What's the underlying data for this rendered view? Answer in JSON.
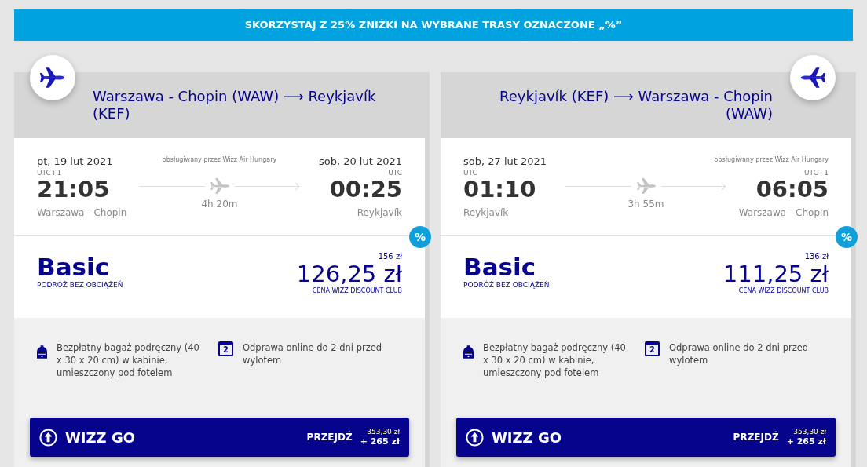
{
  "banner": "SKORZYSTAJ Z 25% ZNIŻKI NA WYBRANE TRASY OZNACZONE „%”",
  "flights": [
    {
      "kind": "outbound",
      "route": {
        "from": "Warszawa - Chopin (WAW)",
        "arrow": "⟶",
        "to": "Reykjavík (KEF)"
      },
      "departure": {
        "date": "pt, 19 lut 2021",
        "timezone": "UTC+1",
        "time": "21:05",
        "place": "Warszawa - Chopin"
      },
      "operator": "obsługiwany przez Wizz Air Hungary",
      "duration": "4h 20m",
      "arrival": {
        "date": "sob, 20 lut 2021",
        "timezone": "UTC",
        "time": "00:25",
        "place": "Reykjavík"
      },
      "discount_badge": "%",
      "fare": {
        "name": "Basic",
        "subtitle": "PODRÓŻ BEZ OBCIĄŻEŃ",
        "old_price": "156 zł",
        "price": "126,25 zł",
        "price_note": "CENA WIZZ DISCOUNT CLUB"
      },
      "features": [
        {
          "kind": "bag",
          "text": "Bezpłatny bagaż podręczny (40 x 30 x 20 cm) w kabinie, umieszczony pod fotelem"
        },
        {
          "kind": "calendar",
          "icon_text": "2",
          "text": "Odprawa online do 2 dni przed wylotem"
        }
      ],
      "upgrade": {
        "label": "WIZZ GO",
        "action": "PRZEJDŹ",
        "old_price": "353,30 zł",
        "extra": "+ 265 zł"
      }
    },
    {
      "kind": "return",
      "route": {
        "from": "Reykjavík (KEF)",
        "arrow": "⟶",
        "to": "Warszawa - Chopin (WAW)"
      },
      "departure": {
        "date": "sob, 27 lut 2021",
        "timezone": "UTC",
        "time": "01:10",
        "place": "Reykjavík"
      },
      "operator": "obsługiwany przez Wizz Air Hungary",
      "duration": "3h 55m",
      "arrival": {
        "timezone": "UTC+1",
        "time": "06:05",
        "place": "Warszawa - Chopin"
      },
      "discount_badge": "%",
      "fare": {
        "name": "Basic",
        "subtitle": "PODRÓŻ BEZ OBCIĄŻEŃ",
        "old_price": "136 zł",
        "price": "111,25 zł",
        "price_note": "CENA WIZZ DISCOUNT CLUB"
      },
      "features": [
        {
          "kind": "bag",
          "text": "Bezpłatny bagaż podręczny (40 x 30 x 20 cm) w kabinie, umieszczony pod fotelem"
        },
        {
          "kind": "calendar",
          "icon_text": "2",
          "text": "Odprawa online do 2 dni przed wylotem"
        }
      ],
      "upgrade": {
        "label": "WIZZ GO",
        "action": "PRZEJDŹ",
        "old_price": "353,30 zł",
        "extra": "+ 265 zł"
      }
    }
  ]
}
